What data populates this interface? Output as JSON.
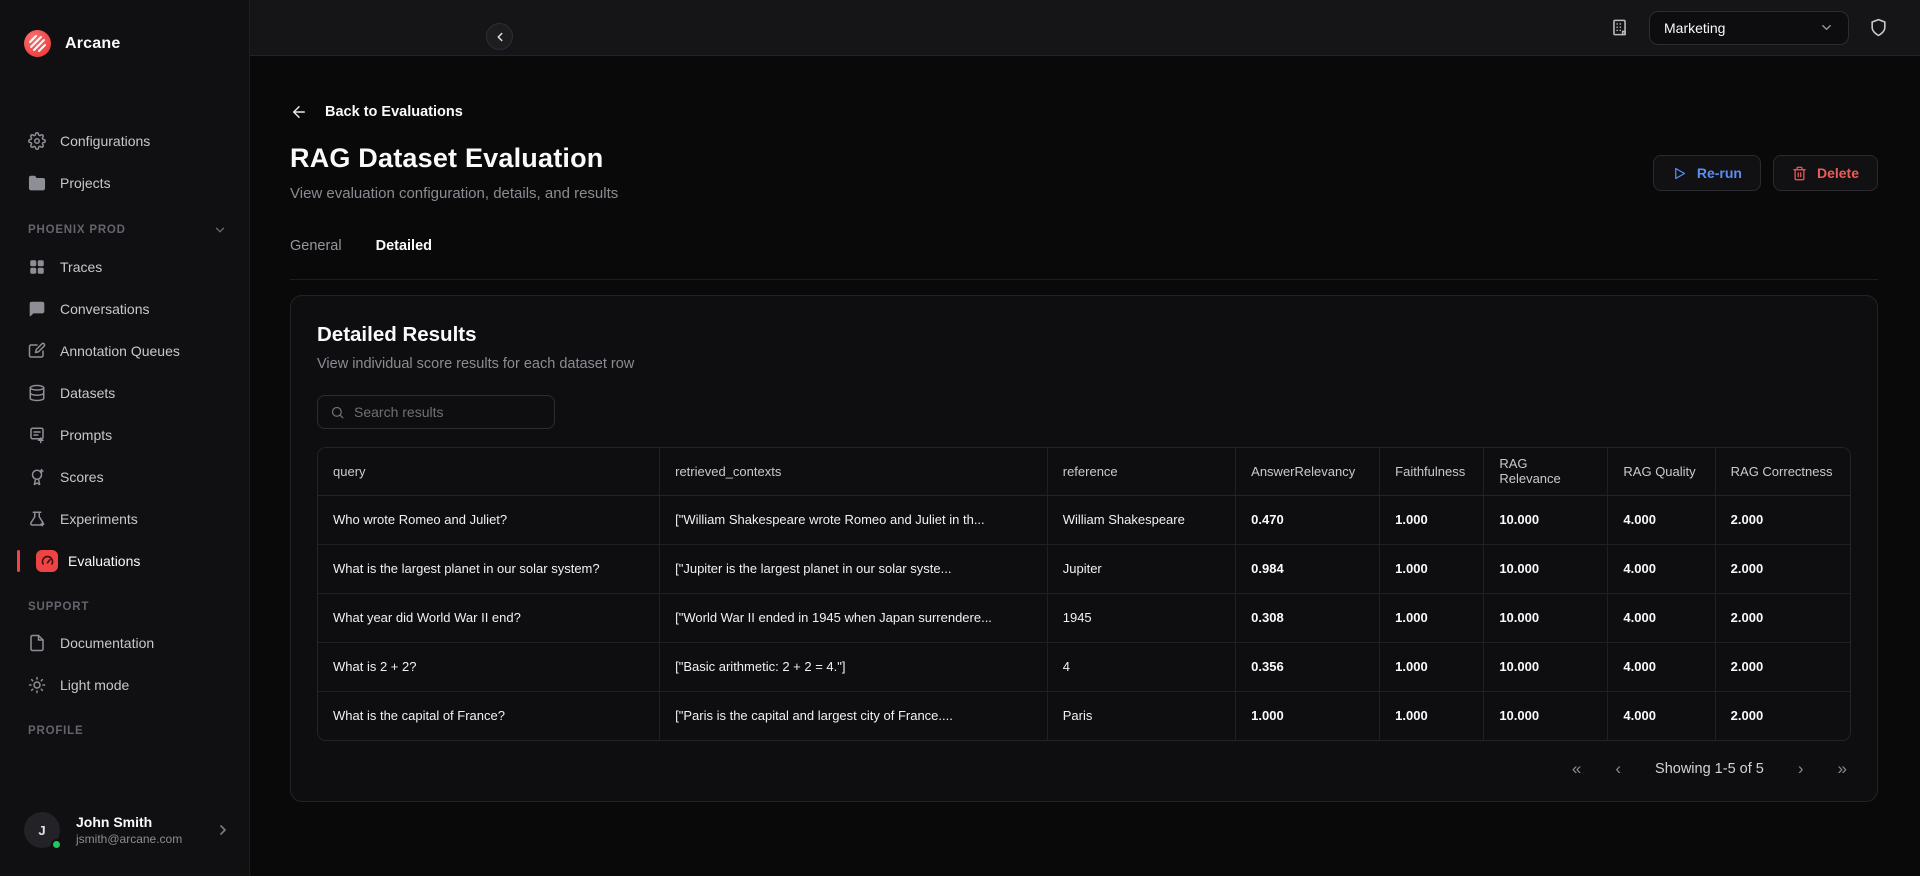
{
  "brand": {
    "name": "Arcane"
  },
  "colors": {
    "accent_red": "#ef4444",
    "rerun_blue": "#5b8df5",
    "delete_red": "#ef5a5a",
    "online_green": "#22c55e"
  },
  "topbar": {
    "workspace_selected": "Marketing"
  },
  "sidebar": {
    "items_top": [
      {
        "label": "Configurations"
      },
      {
        "label": "Projects"
      }
    ],
    "sections": {
      "project": "PHOENIX PROD",
      "support": "SUPPORT",
      "profile": "PROFILE"
    },
    "items_project": [
      {
        "label": "Traces"
      },
      {
        "label": "Conversations"
      },
      {
        "label": "Annotation Queues"
      },
      {
        "label": "Datasets"
      },
      {
        "label": "Prompts"
      },
      {
        "label": "Scores"
      },
      {
        "label": "Experiments"
      },
      {
        "label": "Evaluations"
      }
    ],
    "items_support": [
      {
        "label": "Documentation"
      },
      {
        "label": "Light mode"
      }
    ],
    "profile": {
      "initial": "J",
      "name": "John Smith",
      "email": "jsmith@arcane.com"
    }
  },
  "page": {
    "back": "Back to Evaluations",
    "title": "RAG Dataset Evaluation",
    "subtitle": "View evaluation configuration, details, and results",
    "rerun": "Re-run",
    "delete": "Delete",
    "tabs": {
      "general": "General",
      "detailed": "Detailed"
    }
  },
  "results": {
    "title": "Detailed Results",
    "subtitle": "View individual score results for each dataset row",
    "search_placeholder": "Search results",
    "columns": [
      "query",
      "retrieved_contexts",
      "reference",
      "AnswerRelevancy",
      "Faithfulness",
      "RAG Relevance",
      "RAG Quality",
      "RAG Correctness"
    ],
    "rows": [
      [
        "Who wrote Romeo and Juliet?",
        "[\"William Shakespeare wrote Romeo and Juliet in th...",
        "William Shakespeare",
        "0.470",
        "1.000",
        "10.000",
        "4.000",
        "2.000"
      ],
      [
        "What is the largest planet in our solar system?",
        "[\"Jupiter is the largest planet in our solar syste...",
        "Jupiter",
        "0.984",
        "1.000",
        "10.000",
        "4.000",
        "2.000"
      ],
      [
        "What year did World War II end?",
        "[\"World War II ended in 1945 when Japan surrendere...",
        "1945",
        "0.308",
        "1.000",
        "10.000",
        "4.000",
        "2.000"
      ],
      [
        "What is 2 + 2?",
        "[\"Basic arithmetic: 2 + 2 = 4.\"]",
        "4",
        "0.356",
        "1.000",
        "10.000",
        "4.000",
        "2.000"
      ],
      [
        "What is the capital of France?",
        "[\"Paris is the capital and largest city of France....",
        "Paris",
        "1.000",
        "1.000",
        "10.000",
        "4.000",
        "2.000"
      ]
    ],
    "pagination": "Showing 1-5 of 5"
  }
}
